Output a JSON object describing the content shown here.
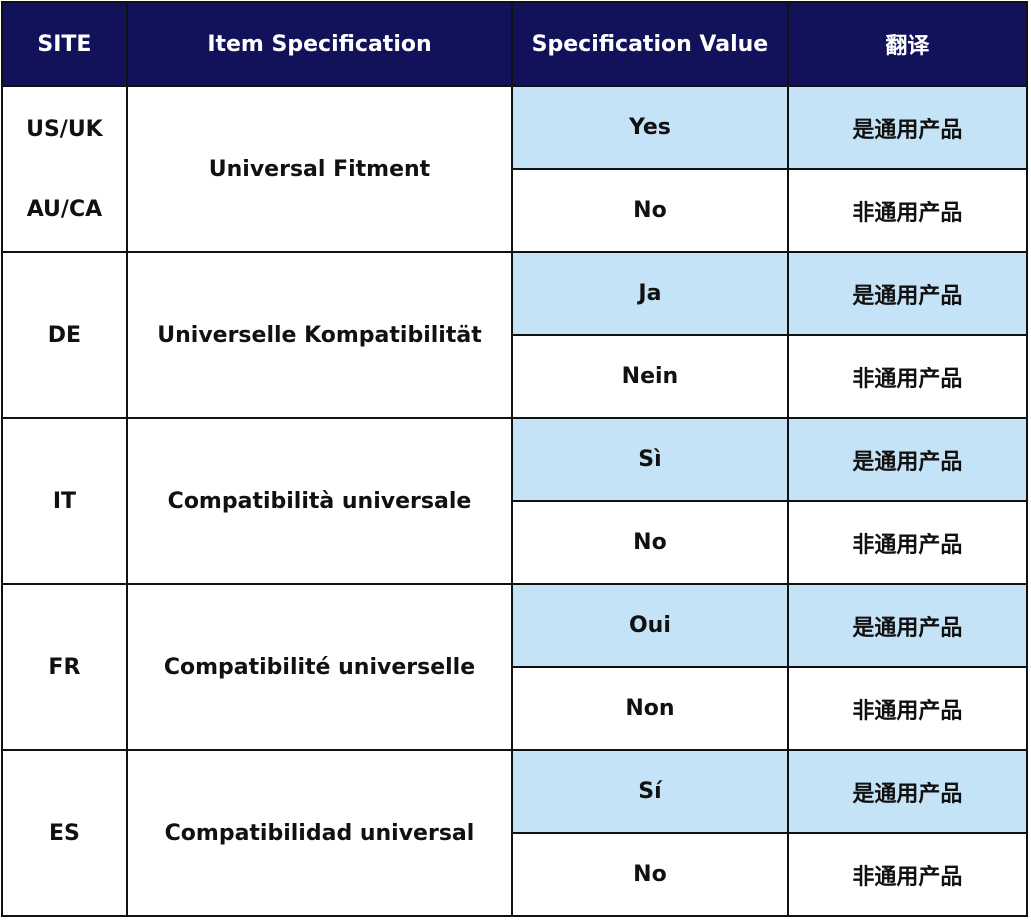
{
  "headers": [
    "SITE",
    "Item Specification",
    "Specification Value",
    "翻译"
  ],
  "groups": [
    {
      "site": [
        "US/UK",
        "AU/CA"
      ],
      "spec": "Universal Fitment",
      "values": [
        {
          "value": "Yes",
          "translation": "是通用产品"
        },
        {
          "value": "No",
          "translation": "非通用产品"
        }
      ]
    },
    {
      "site": [
        "DE"
      ],
      "spec": "Universelle Kompatibilität",
      "values": [
        {
          "value": "Ja",
          "translation": "是通用产品"
        },
        {
          "value": "Nein",
          "translation": "非通用产品"
        }
      ]
    },
    {
      "site": [
        "IT"
      ],
      "spec": "Compatibilità  universale",
      "values": [
        {
          "value": "Sì",
          "translation": "是通用产品"
        },
        {
          "value": "No",
          "translation": "非通用产品"
        }
      ]
    },
    {
      "site": [
        "FR"
      ],
      "spec": "Compatibilité  universelle",
      "values": [
        {
          "value": "Oui",
          "translation": "是通用产品"
        },
        {
          "value": "Non",
          "translation": "非通用产品"
        }
      ]
    },
    {
      "site": [
        "ES"
      ],
      "spec": "Compatibilidad universal",
      "values": [
        {
          "value": "Sí",
          "translation": "是通用产品"
        },
        {
          "value": "No",
          "translation": "非通用产品"
        }
      ]
    }
  ],
  "colors": {
    "header_bg": "#12125a",
    "highlight_bg": "#c5e3f6"
  }
}
